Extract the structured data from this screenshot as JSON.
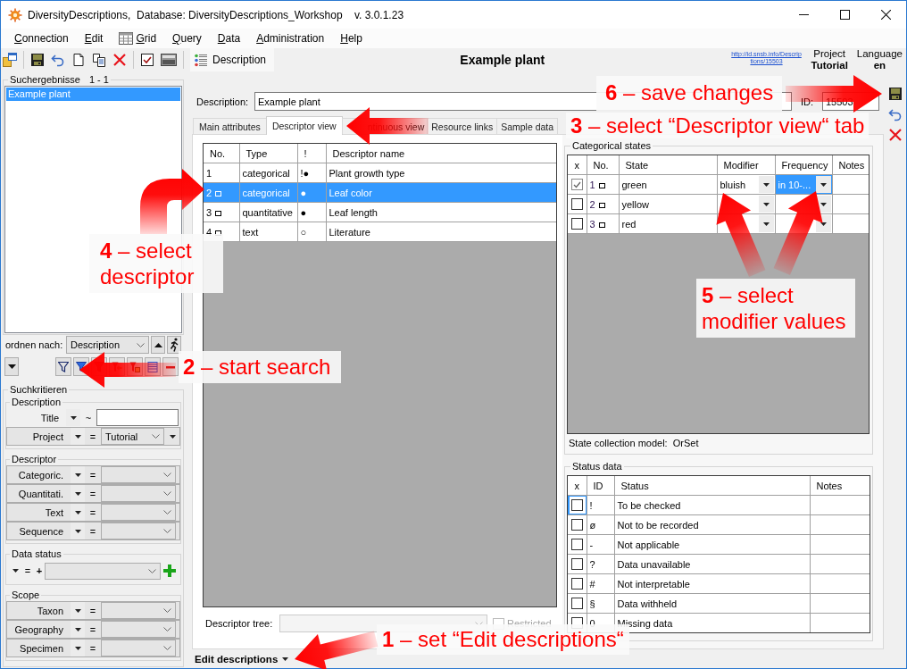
{
  "window": {
    "title": "DiversityDescriptions,  Database: DiversityDescriptions_Workshop    v. 3.0.1.23"
  },
  "menu": [
    {
      "label": "Connection",
      "icon": false
    },
    {
      "label": "Edit",
      "icon": false
    },
    {
      "label": "Grid",
      "icon": true
    },
    {
      "label": "Query",
      "icon": false
    },
    {
      "label": "Data",
      "icon": false
    },
    {
      "label": "Administration",
      "icon": false
    },
    {
      "label": "Help",
      "icon": false
    }
  ],
  "toolbar": {
    "view_button": "Description"
  },
  "header": {
    "title": "Example plant",
    "link": "http://id.snsb.info/Descriptions/15503",
    "project": {
      "label": "Project",
      "value": "Tutorial"
    },
    "language": {
      "label": "Language",
      "value": "en"
    }
  },
  "search_results": {
    "title": "Suchergebnisse",
    "count": "1 - 1",
    "items": [
      {
        "label": "Example plant",
        "selected": true
      }
    ]
  },
  "sort": {
    "label": "ordnen nach:",
    "value": "Description"
  },
  "search_criteria": {
    "title": "Suchkritieren",
    "groups": [
      {
        "title": "Description",
        "rows": [
          {
            "kind": "text",
            "label": "Title",
            "operator": "~",
            "extra_menu": false
          },
          {
            "kind": "combo",
            "label": "Project",
            "operator": "=",
            "value": "Tutorial",
            "extra_menu": true
          }
        ]
      },
      {
        "title": "Descriptor",
        "rows": [
          {
            "kind": "combo",
            "label": "Categoric.",
            "operator": "=",
            "extra_menu": false
          },
          {
            "kind": "combo",
            "label": "Quantitati.",
            "operator": "=",
            "extra_menu": false
          },
          {
            "kind": "combo",
            "label": "Text",
            "operator": "=",
            "extra_menu": false
          },
          {
            "kind": "combo",
            "label": "Sequence",
            "operator": "=",
            "extra_menu": false
          }
        ]
      },
      {
        "title": "Data status",
        "rows": [
          {
            "kind": "status",
            "operator": "=",
            "prefix": "+"
          }
        ]
      },
      {
        "title": "Scope",
        "rows": [
          {
            "kind": "combo",
            "label": "Taxon",
            "operator": "=",
            "extra_menu": false
          },
          {
            "kind": "combo",
            "label": "Geography",
            "operator": "=",
            "extra_menu": false
          },
          {
            "kind": "combo",
            "label": "Specimen",
            "operator": "=",
            "extra_menu": false
          }
        ]
      }
    ]
  },
  "description_field": {
    "label": "Description:",
    "value": "Example plant"
  },
  "id_field": {
    "label": "ID:",
    "value": "15503"
  },
  "tabs": [
    {
      "label": "Main attributes",
      "selected": false
    },
    {
      "label": "Descriptor view",
      "selected": true
    },
    {
      "label": "ntinuous view",
      "selected": false
    },
    {
      "label": "Resource links",
      "selected": false
    },
    {
      "label": "Sample data",
      "selected": false
    }
  ],
  "descriptors": {
    "columns": [
      "No.",
      "Type",
      "!",
      "Descriptor name"
    ],
    "rows": [
      {
        "no": "1",
        "marker": false,
        "type": "categorical",
        "flags": "!●",
        "name": "Plant growth type",
        "selected": false
      },
      {
        "no": "2",
        "marker": true,
        "type": "categorical",
        "flags": "●",
        "name": "Leaf color",
        "selected": true
      },
      {
        "no": "3",
        "marker": true,
        "type": "quantitative",
        "flags": "●",
        "name": "Leaf length",
        "selected": false
      },
      {
        "no": "4",
        "marker": true,
        "type": "text",
        "flags": "○",
        "name": "Literature",
        "selected": false
      }
    ]
  },
  "descriptor_tree": {
    "label": "Descriptor tree:",
    "restricted": {
      "label": "Restricted",
      "checked": false,
      "disabled": true
    }
  },
  "categorical_states": {
    "title": "Categorical states",
    "columns": [
      "x",
      "No.",
      "State",
      "Modifier",
      "Frequency",
      "Notes"
    ],
    "rows": [
      {
        "checked": true,
        "no": "1",
        "marker": true,
        "state": "green",
        "modifier": "bluish",
        "frequency": "in 10-...",
        "frequency_selected": true
      },
      {
        "checked": false,
        "no": "2",
        "marker": true,
        "state": "yellow",
        "frequency_selected": false
      },
      {
        "checked": false,
        "no": "3",
        "marker": true,
        "state": "red",
        "frequency_selected": false
      }
    ],
    "collection_model": "State collection model:  OrSet"
  },
  "status_data": {
    "title": "Status data",
    "columns": [
      "x",
      "ID",
      "Status",
      "Notes"
    ],
    "rows": [
      {
        "checked": false,
        "focused": true,
        "id": "!",
        "status": "To be checked"
      },
      {
        "checked": false,
        "focused": false,
        "id": "ø",
        "status": "Not to be recorded"
      },
      {
        "checked": false,
        "focused": false,
        "id": "-",
        "status": "Not applicable"
      },
      {
        "checked": false,
        "focused": false,
        "id": "?",
        "status": "Data unavailable"
      },
      {
        "checked": false,
        "focused": false,
        "id": "#",
        "status": "Not interpretable"
      },
      {
        "checked": false,
        "focused": false,
        "id": "§",
        "status": "Data withheld"
      },
      {
        "checked": false,
        "focused": false,
        "id": "0",
        "status": "Missing data"
      }
    ]
  },
  "mode_button": "Edit descriptions",
  "annotations": [
    {
      "text": "**1** – set “Edit descriptions“"
    },
    {
      "text": "**2** – start search"
    },
    {
      "text": "**3** – select “Descriptor view“ tab"
    },
    {
      "text": "**4** – select descriptor"
    },
    {
      "text": "**5** – select modifier values"
    },
    {
      "text": "**6** – save changes"
    }
  ]
}
